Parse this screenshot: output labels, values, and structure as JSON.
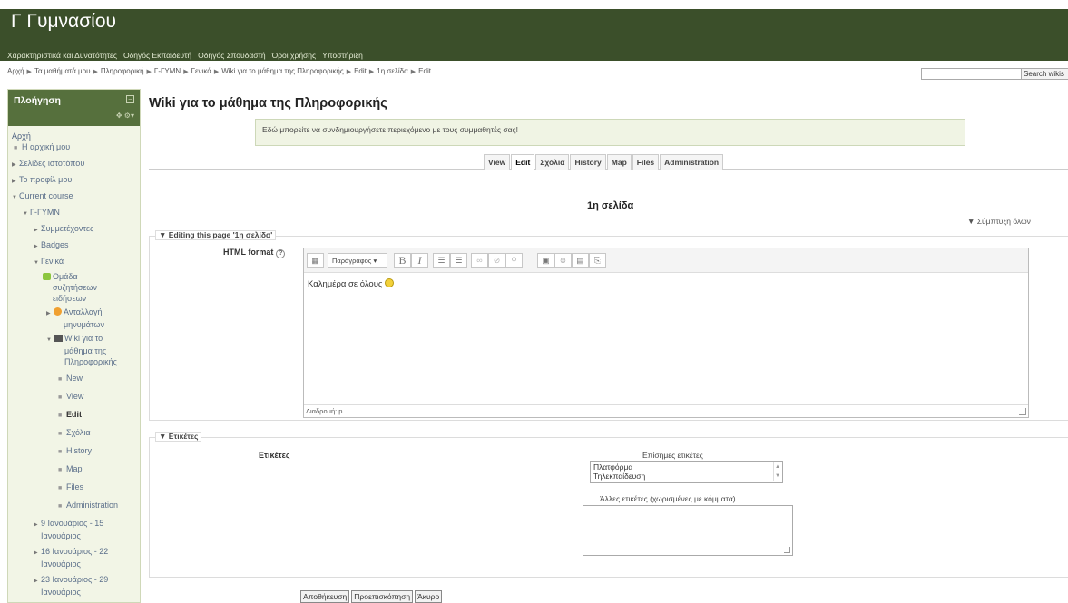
{
  "site_title": "Γ Γυμνασίου",
  "topnav": [
    "Χαρακτηριστικά και Δυνατότητες",
    "Οδηγός Εκπαιδευτή",
    "Οδηγός Σπουδαστή",
    "Όροι χρήσης",
    "Υποστήριξη"
  ],
  "breadcrumb": [
    "Αρχή",
    "Τα μαθήματά μου",
    "Πληροφορική",
    "Γ-ΓΥΜΝ",
    "Γενικά",
    "Wiki για το μάθημα της Πληροφορικής",
    "Edit",
    "1η σελίδα",
    "Edit"
  ],
  "search": {
    "button": "Search wikis"
  },
  "sidebar": {
    "title": "Πλοήγηση",
    "home": "Αρχή",
    "my_home": "Η αρχική μου",
    "site_pages": "Σελίδες ιστοτόπου",
    "my_profile": "Το προφίλ μου",
    "current_course": "Current course",
    "course": "Γ-ΓΥΜΝ",
    "participants": "Συμμετέχοντες",
    "badges": "Badges",
    "general": "Γενικά",
    "forum": [
      "Ομάδα",
      "συζητήσεων",
      "ειδήσεων"
    ],
    "messages": [
      "Ανταλλαγή",
      "μηνυμάτων"
    ],
    "wiki": [
      "Wiki για το",
      "μάθημα της",
      "Πληροφορικής"
    ],
    "wiki_items": [
      "New",
      "View",
      "Edit",
      "Σχόλια",
      "History",
      "Map",
      "Files",
      "Administration"
    ],
    "weeks": [
      [
        "9 Ιανουάριος - 15",
        "Ιανουάριος"
      ],
      [
        "16 Ιανουάριος - 22",
        "Ιανουάριος"
      ],
      [
        "23 Ιανουάριος - 29",
        "Ιανουάριος"
      ]
    ]
  },
  "main": {
    "title": "Wiki για το μάθημα της Πληροφορικής",
    "intro": "Εδώ μπορείτε να συνδημιουργήσετε περιεχόμενο με τους συμμαθητές σας!",
    "tabs": [
      "View",
      "Edit",
      "Σχόλια",
      "History",
      "Map",
      "Files",
      "Administration"
    ],
    "active_tab": "Edit",
    "page_heading": "1η σελίδα",
    "collapse_all": "Σύμπτυξη όλων"
  },
  "editing": {
    "legend": "Editing this page '1η σελίδα'",
    "format_label": "HTML format",
    "paragraph_select": "Παράγραφος",
    "content": "Καλημέρα σε όλους",
    "status_path": "Διαδρομή: p"
  },
  "tags": {
    "legend": "Ετικέτες",
    "label": "Ετικέτες",
    "official_title": "Επίσημες ετικέτες",
    "official_options": [
      "Πλατφόρμα",
      "Τηλεκπαίδευση"
    ],
    "other_title": "Άλλες ετικέτες (χωρισμένες με κόμματα)"
  },
  "buttons": {
    "save": "Αποθήκευση",
    "preview": "Προεπισκόπηση",
    "cancel": "Άκυρο"
  }
}
